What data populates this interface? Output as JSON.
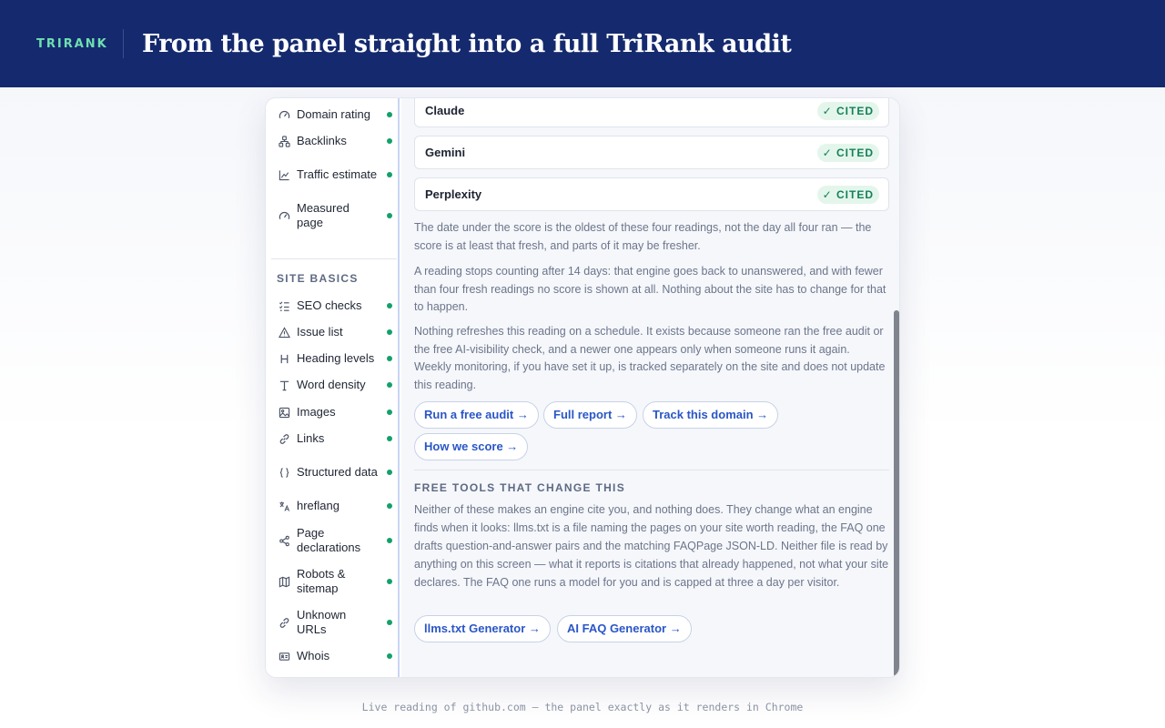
{
  "header": {
    "brand": "TRIRANK",
    "headline": "From the panel straight into a full TriRank audit"
  },
  "sidebar": {
    "items_top": [
      {
        "label": "Domain rating",
        "icon": "gauge-icon"
      },
      {
        "label": "Backlinks",
        "icon": "network-icon"
      },
      {
        "label": "Traffic estimate",
        "icon": "chart-line-icon"
      },
      {
        "label": "Measured page",
        "icon": "gauge-icon"
      }
    ],
    "section_heading": "SITE BASICS",
    "items": [
      {
        "label": "SEO checks",
        "icon": "checklist-icon"
      },
      {
        "label": "Issue list",
        "icon": "warning-icon"
      },
      {
        "label": "Heading levels",
        "icon": "heading-icon"
      },
      {
        "label": "Word density",
        "icon": "text-icon"
      },
      {
        "label": "Images",
        "icon": "image-icon"
      },
      {
        "label": "Links",
        "icon": "link-icon"
      },
      {
        "label": "Structured data",
        "icon": "braces-icon"
      },
      {
        "label": "hreflang",
        "icon": "translate-icon"
      },
      {
        "label": "Page declarations",
        "icon": "share-icon"
      },
      {
        "label": "Robots & sitemap",
        "icon": "map-icon"
      },
      {
        "label": "Unknown URLs",
        "icon": "link-icon"
      },
      {
        "label": "Whois",
        "icon": "id-card-icon"
      }
    ],
    "status_color": "#15a06a"
  },
  "engines": [
    {
      "name": "Claude",
      "status": "✓ CITED"
    },
    {
      "name": "Gemini",
      "status": "✓ CITED"
    },
    {
      "name": "Perplexity",
      "status": "✓ CITED"
    }
  ],
  "paragraphs": {
    "p1": "The date under the score is the oldest of these four readings, not the day all four ran — the score is at least that fresh, and parts of it may be fresher.",
    "p2": "A reading stops counting after 14 days: that engine goes back to unanswered, and with fewer than four fresh readings no score is shown at all. Nothing about the site has to change for that to happen.",
    "p3": "Nothing refreshes this reading on a schedule. It exists because someone ran the free audit or the free AI-visibility check, and a newer one appears only when someone runs it again. Weekly monitoring, if you have set it up, is tracked separately on the site and does not update this reading."
  },
  "actions": {
    "run_audit": "Run a free audit →",
    "full_report": "Full report →",
    "track_domain": "Track this domain →",
    "how_we_score": "How we score →"
  },
  "tools": {
    "heading": "FREE TOOLS THAT CHANGE THIS",
    "text": "Neither of these makes an engine cite you, and nothing does. They change what an engine finds when it looks: llms.txt is a file naming the pages on your site worth reading, the FAQ one drafts question-and-answer pairs and the matching FAQPage JSON-LD. Neither file is read by anything on this screen — what it reports is citations that already happened, not what your site declares. The FAQ one runs a model for you and is capped at three a day per visitor.",
    "llms_button": "llms.txt Generator →",
    "faq_button": "AI FAQ Generator →"
  },
  "caption": "Live reading of github.com — the panel exactly as it renders in Chrome",
  "colors": {
    "header_bg": "#152a6e",
    "brand": "#6ee0b0",
    "accent": "#2a56c6",
    "cited_bg": "#e4f6ec",
    "cited_text": "#14805a"
  }
}
